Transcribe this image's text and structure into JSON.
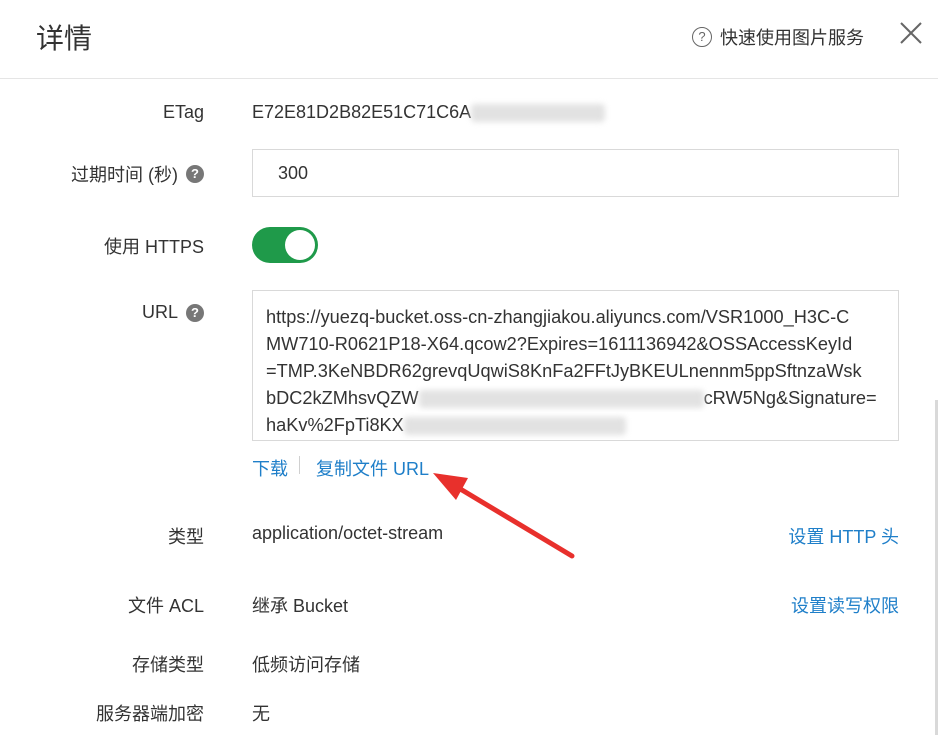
{
  "header": {
    "title": "详情",
    "help_icon": "question-circle-icon",
    "quick_help_label": "快速使用图片服务",
    "close_icon": "close-icon"
  },
  "fields": {
    "etag": {
      "label": "ETag",
      "value": "E72E81D2B82E51C71C6A"
    },
    "expire": {
      "label": "过期时间 (秒)",
      "value": "300",
      "help_icon": "question-help-icon"
    },
    "https": {
      "label": "使用 HTTPS",
      "enabled": true
    },
    "url": {
      "label": "URL",
      "help_icon": "question-help-icon",
      "lines": [
        "https://yuezq-bucket.oss-cn-zhangjiakou.aliyuncs.com/VSR1000_H3C-C",
        "MW710-R0621P18-X64.qcow2?Expires=1611136942&OSSAccessKeyId",
        "=TMP.3KeNBDR62grevqUqwiS8KnFa2FFtJyBKEULnennm5ppSftnzaWsk",
        "bDC2kZMhsvQZW",
        "cRW5Ng&Signature=",
        "haKv%2FpTi8KX"
      ],
      "download_label": "下载",
      "copy_label": "复制文件 URL"
    },
    "type": {
      "label": "类型",
      "value": "application/octet-stream",
      "action_label": "设置 HTTP 头"
    },
    "acl": {
      "label": "文件 ACL",
      "value": "继承 Bucket",
      "action_label": "设置读写权限"
    },
    "storage": {
      "label": "存储类型",
      "value": "低频访问存储"
    },
    "encryption": {
      "label": "服务器端加密",
      "value": "无"
    }
  },
  "colors": {
    "link": "#1f7fc9",
    "toggle_on": "#1f9a4a",
    "annotation_arrow": "#e8302c"
  }
}
